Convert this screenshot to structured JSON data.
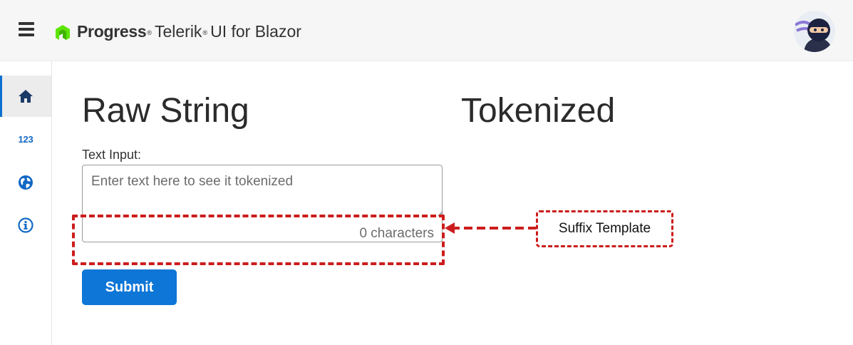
{
  "header": {
    "brand_primary": "Progress",
    "brand_trademark_1": "®",
    "brand_secondary": "Telerik",
    "brand_trademark_2": "®",
    "brand_product": "UI for Blazor",
    "menu_icon": "hamburger-icon",
    "avatar_icon": "ninja-avatar"
  },
  "sidebar": {
    "items": [
      {
        "icon": "home-icon",
        "active": true
      },
      {
        "icon": "numbers-icon",
        "label": "123",
        "active": false
      },
      {
        "icon": "globe-icon",
        "active": false
      },
      {
        "icon": "info-icon",
        "active": false
      }
    ]
  },
  "main": {
    "raw_title": "Raw String",
    "tokenized_title": "Tokenized",
    "input_label": "Text Input:",
    "input_placeholder": "Enter text here to see it tokenized",
    "input_value": "",
    "char_count": "0 characters",
    "submit_label": "Submit"
  },
  "annotation": {
    "label": "Suffix Template"
  },
  "colors": {
    "accent": "#0e76d6",
    "annotation": "#cc1d1d",
    "header_bg": "#f6f6f6",
    "logo_green": "#5ce500"
  }
}
